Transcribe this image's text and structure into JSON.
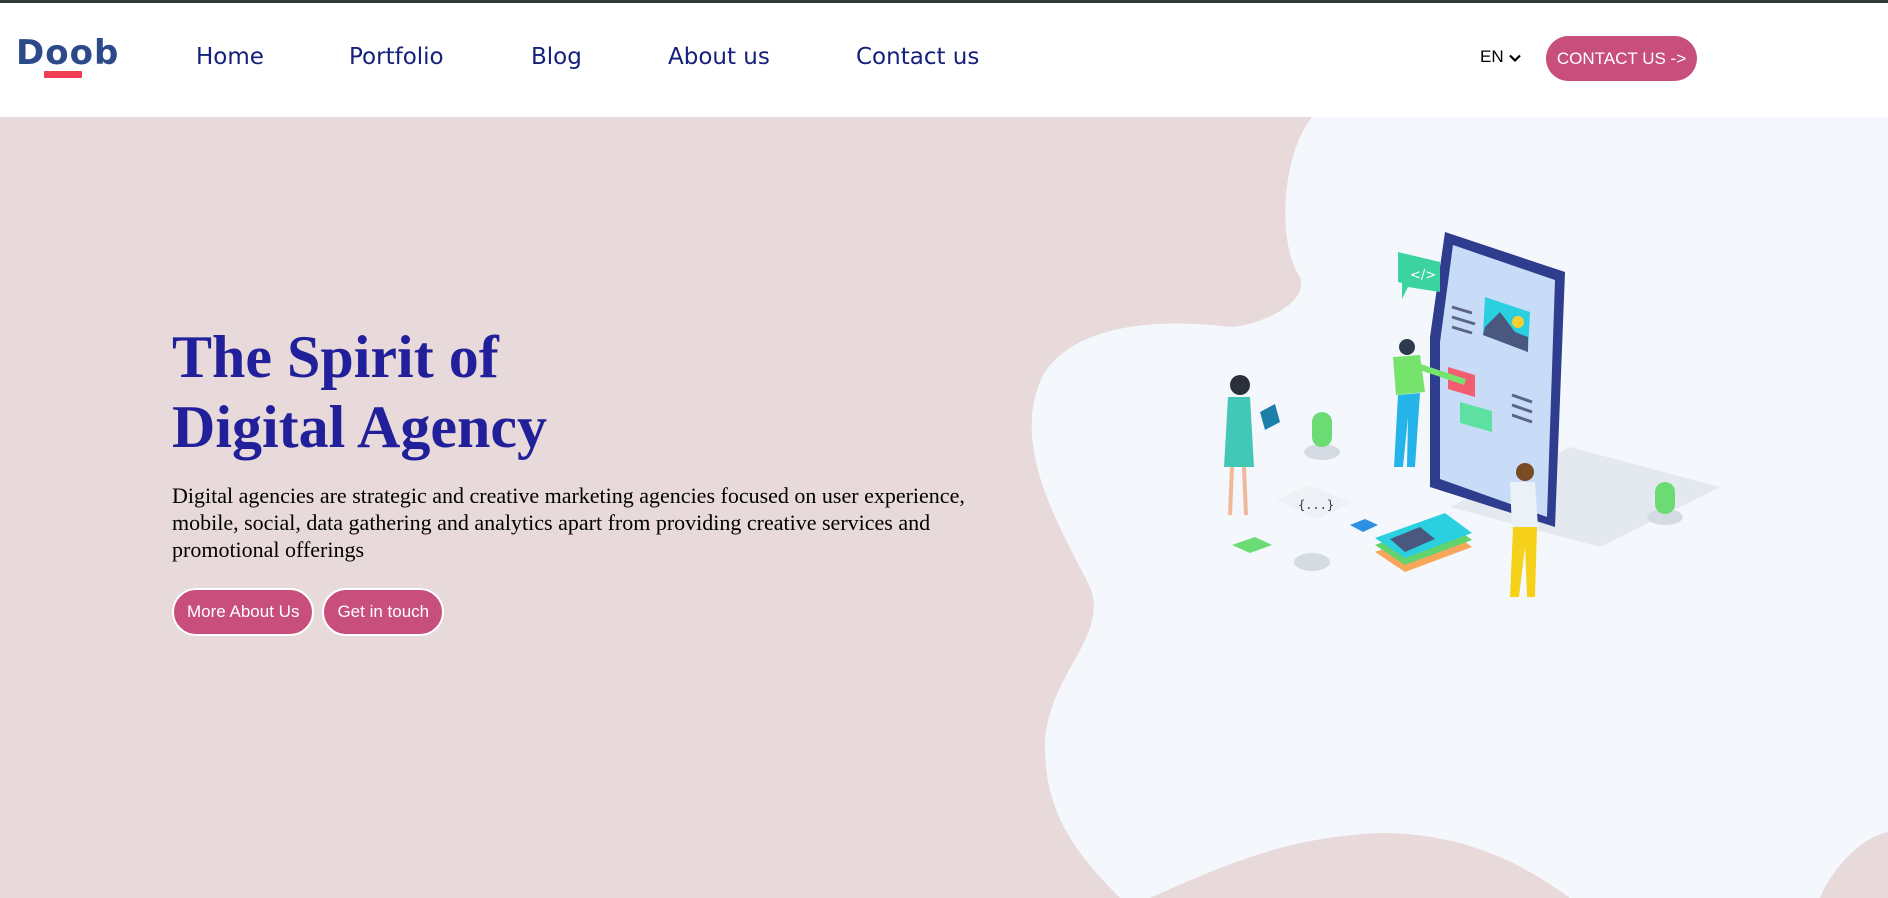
{
  "brand": {
    "name": "Doob",
    "accent": "#ee3d55",
    "color": "#2c4a8a"
  },
  "nav": {
    "items": [
      {
        "label": "Home"
      },
      {
        "label": "Portfolio"
      },
      {
        "label": "Blog"
      },
      {
        "label": "About us"
      },
      {
        "label": "Contact us"
      }
    ]
  },
  "language": {
    "selected": "EN",
    "icon": "chevron-down-icon"
  },
  "header_cta": {
    "label": "CONTACT US ->"
  },
  "hero": {
    "title_line1": "The Spirit of",
    "title_line2": "Digital Agency",
    "description": "Digital agencies are strategic and creative marketing agencies focused on user experience, mobile, social, data gathering and analytics apart from providing creative services and promotional offerings",
    "buttons": [
      {
        "label": "More About Us"
      },
      {
        "label": "Get in touch"
      }
    ]
  },
  "colors": {
    "hero_bg": "#e8d9da",
    "blob": "#f4f8fc",
    "title": "#21209a",
    "nav_text": "#15207b",
    "button_bg": "#c84f7c"
  }
}
